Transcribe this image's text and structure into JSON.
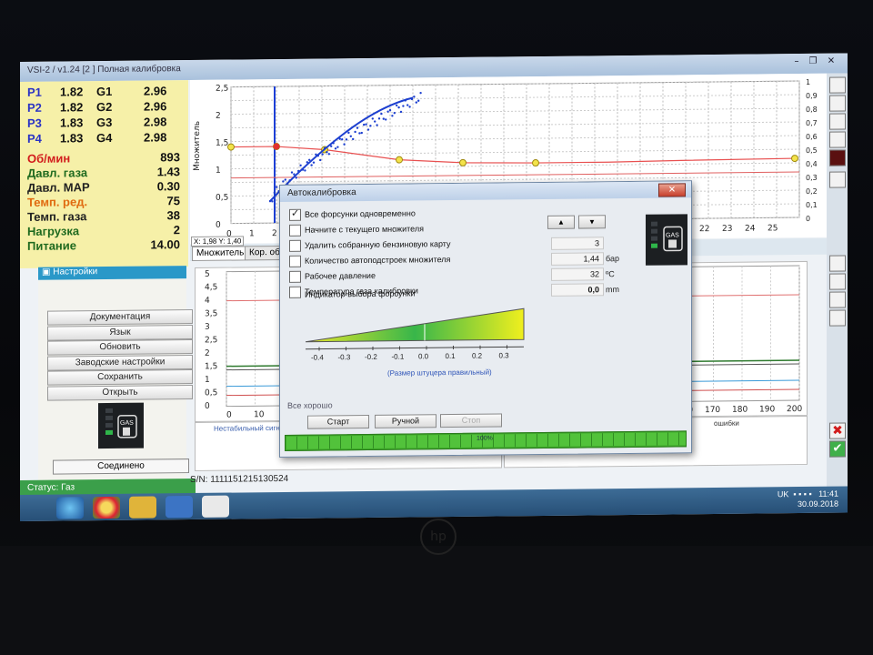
{
  "window": {
    "title": "VSI-2 / v1.24 [2 ] Полная калибровка"
  },
  "injectors": [
    {
      "p": "P1",
      "pval": "1.82",
      "g": "G1",
      "gval": "2.96"
    },
    {
      "p": "P2",
      "pval": "1.82",
      "g": "G2",
      "gval": "2.96"
    },
    {
      "p": "P3",
      "pval": "1.83",
      "g": "G3",
      "gval": "2.98"
    },
    {
      "p": "P4",
      "pval": "1.83",
      "g": "G4",
      "gval": "2.98"
    }
  ],
  "sensors": [
    {
      "label": "Об/мин",
      "value": "893",
      "color": "#d21c1c"
    },
    {
      "label": "Давл. газа",
      "value": "1.43",
      "color": "#1f6a1f"
    },
    {
      "label": "Давл. MAP",
      "value": "0.30",
      "color": "#222222"
    },
    {
      "label": "Темп. ред.",
      "value": "75",
      "color": "#e06a10"
    },
    {
      "label": "Темп. газа",
      "value": "38",
      "color": "#222222"
    },
    {
      "label": "Нагрузка",
      "value": "2",
      "color": "#1f6a1f"
    },
    {
      "label": "Питание",
      "value": "14.00",
      "color": "#1f6a1f"
    }
  ],
  "settings": {
    "header": "Настройки",
    "buttons": [
      "Документация",
      "Язык",
      "Обновить",
      "Заводские настройки",
      "Сохранить",
      "Открыть"
    ],
    "connection": "Соединено",
    "status": "Статус: Газ"
  },
  "chart_top": {
    "ylabel": "Множитель",
    "yticks": [
      "2,5",
      "2",
      "1,5",
      "1",
      "0,5",
      "0"
    ],
    "right_ticks": [
      "1",
      "0,9",
      "0,8",
      "0,7",
      "0,6",
      "0,5",
      "0,4",
      "0,3",
      "0,2",
      "0,1",
      "0"
    ],
    "xticks": [
      "0",
      "1",
      "2",
      "21",
      "22",
      "23",
      "24",
      "25"
    ],
    "coord": "X: 1,98  Y: 1,40",
    "tabs": [
      "Множитель",
      "Кор. об"
    ]
  },
  "chart_bottom": {
    "yticks": [
      "5",
      "4,5",
      "4",
      "3,5",
      "3",
      "2,5",
      "2",
      "1,5",
      "1",
      "0,5",
      "0"
    ],
    "xticks": [
      "0",
      "10",
      "20",
      "160",
      "170",
      "180",
      "190",
      "200"
    ],
    "footer_left": "Нестабильный сигнал з",
    "footer_right": "ошибки"
  },
  "sn": "S/N: 1111151215130524",
  "tray": {
    "lang": "UK",
    "time": "11:41",
    "date": "30.09.2018"
  },
  "dialog": {
    "title": "Автокалибровка",
    "options": [
      {
        "label": "Все форсунки одновременно",
        "checked": true
      },
      {
        "label": "Начните с текущего множителя",
        "checked": false
      },
      {
        "label": "Удалить собранную бензиновую карту",
        "checked": false
      },
      {
        "label": "Количество автоподстроек множителя",
        "checked": false
      },
      {
        "label": "Рабочее давление",
        "checked": false
      },
      {
        "label": "Температура газа калибровки",
        "checked": false
      }
    ],
    "indicator_label": "Индикатор выбора форсунки",
    "values": {
      "count": "3",
      "pressure": "1,44",
      "temp": "32",
      "indicator": "0,0"
    },
    "units": {
      "pressure": "бар",
      "temp": "ºC",
      "indicator": "mm"
    },
    "scale_ticks": [
      "-0.4",
      "-0.3",
      "-0.2",
      "-0.1",
      "0.0",
      "0.1",
      "0.2",
      "0.3"
    ],
    "scale_caption": "(Размер штуцера правильный)",
    "ok_text": "Все хорошо",
    "buttons": {
      "start": "Старт",
      "manual": "Ручной",
      "stop": "Стоп"
    },
    "progress_text": "100%",
    "progress_value": 1.0
  }
}
